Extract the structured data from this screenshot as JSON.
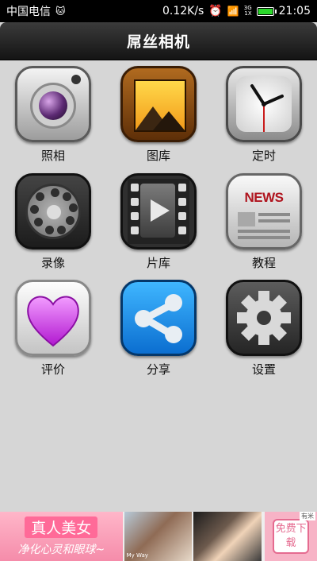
{
  "status_bar": {
    "carrier": "中国电信",
    "speed": "0.12K/s",
    "network_top": "3G",
    "network_bottom": "1X",
    "time": "21:05",
    "battery_level": 0.9
  },
  "title_bar": {
    "title": "屌丝相机"
  },
  "grid": {
    "items": [
      {
        "label": "照相",
        "icon": "camera-icon"
      },
      {
        "label": "图库",
        "icon": "gallery-icon"
      },
      {
        "label": "定时",
        "icon": "clock-icon"
      },
      {
        "label": "录像",
        "icon": "rotary-dial-icon"
      },
      {
        "label": "片库",
        "icon": "film-icon"
      },
      {
        "label": "教程",
        "icon": "news-icon"
      },
      {
        "label": "评价",
        "icon": "heart-icon"
      },
      {
        "label": "分享",
        "icon": "share-icon"
      },
      {
        "label": "设置",
        "icon": "gear-icon"
      }
    ],
    "news_icon_text": "NEWS"
  },
  "ad": {
    "title": "真人美女",
    "subtitle": "净化心灵和眼球~",
    "photo1_caption": "My Way",
    "download_label": "免费下载",
    "badge": "有米"
  },
  "colors": {
    "accent_green": "#2bd82b",
    "ad_pink": "#ff6a98",
    "news_red": "#b0151f"
  }
}
